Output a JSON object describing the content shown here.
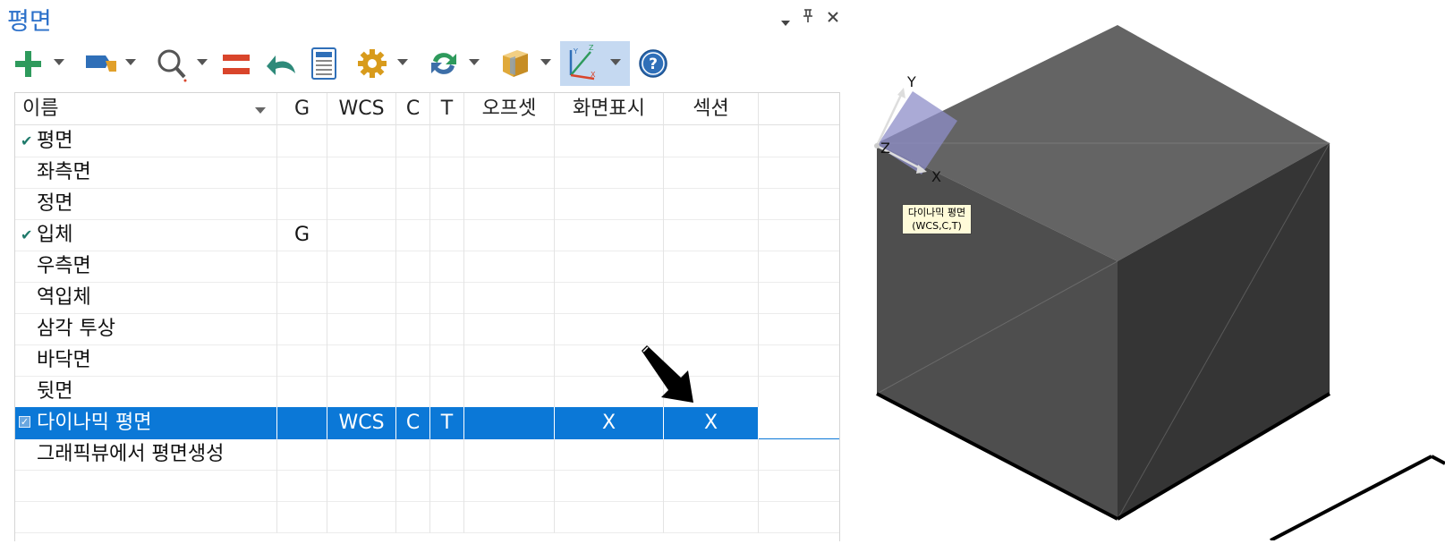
{
  "panel": {
    "title": "평면",
    "controls": {
      "dropdown": "▾",
      "pin": "ᵃ",
      "close": "✕"
    }
  },
  "toolbar": {
    "items": [
      {
        "icon": "add-icon",
        "dropdown": true
      },
      {
        "icon": "flag-icon",
        "dropdown": true
      },
      {
        "icon": "search-icon",
        "dropdown": true
      },
      {
        "icon": "equal-icon",
        "dropdown": false
      },
      {
        "icon": "undo-icon",
        "dropdown": false
      },
      {
        "icon": "calculator-icon",
        "dropdown": false
      },
      {
        "icon": "gear-icon",
        "dropdown": true
      },
      {
        "icon": "refresh-icon",
        "dropdown": true
      },
      {
        "icon": "box-icon",
        "dropdown": true
      },
      {
        "icon": "axes-icon",
        "dropdown": true,
        "active": true
      },
      {
        "icon": "help-icon",
        "dropdown": false
      }
    ],
    "colors": {
      "green": "#2e9a5c",
      "blue": "#2f6fb8",
      "red": "#d9452b",
      "gold": "#d89b1c"
    }
  },
  "grid": {
    "headers": [
      "이름",
      "G",
      "WCS",
      "C",
      "T",
      "오프셋",
      "화면표시",
      "섹션"
    ],
    "rows": [
      {
        "name": "평면",
        "checked": true,
        "g": "",
        "wcs": "",
        "c": "",
        "t": "",
        "offset": "",
        "display": "",
        "section": ""
      },
      {
        "name": "좌측면",
        "checked": false,
        "g": "",
        "wcs": "",
        "c": "",
        "t": "",
        "offset": "",
        "display": "",
        "section": ""
      },
      {
        "name": "정면",
        "checked": false,
        "g": "",
        "wcs": "",
        "c": "",
        "t": "",
        "offset": "",
        "display": "",
        "section": ""
      },
      {
        "name": "입체",
        "checked": true,
        "g": "G",
        "wcs": "",
        "c": "",
        "t": "",
        "offset": "",
        "display": "",
        "section": ""
      },
      {
        "name": "우측면",
        "checked": false,
        "g": "",
        "wcs": "",
        "c": "",
        "t": "",
        "offset": "",
        "display": "",
        "section": ""
      },
      {
        "name": "역입체",
        "checked": false,
        "g": "",
        "wcs": "",
        "c": "",
        "t": "",
        "offset": "",
        "display": "",
        "section": ""
      },
      {
        "name": "삼각 투상",
        "checked": false,
        "g": "",
        "wcs": "",
        "c": "",
        "t": "",
        "offset": "",
        "display": "",
        "section": ""
      },
      {
        "name": "바닥면",
        "checked": false,
        "g": "",
        "wcs": "",
        "c": "",
        "t": "",
        "offset": "",
        "display": "",
        "section": ""
      },
      {
        "name": "뒷면",
        "checked": false,
        "g": "",
        "wcs": "",
        "c": "",
        "t": "",
        "offset": "",
        "display": "",
        "section": ""
      },
      {
        "name": "다이나믹 평면",
        "checked": true,
        "selected": true,
        "g": "",
        "wcs": "WCS",
        "c": "C",
        "t": "T",
        "offset": "",
        "display": "X",
        "section": "X"
      },
      {
        "name": "그래픽뷰에서 평면생성",
        "checked": false,
        "g": "",
        "wcs": "",
        "c": "",
        "t": "",
        "offset": "",
        "display": "",
        "section": ""
      },
      {
        "name": "",
        "checked": false,
        "g": "",
        "wcs": "",
        "c": "",
        "t": "",
        "offset": "",
        "display": "",
        "section": ""
      },
      {
        "name": "",
        "checked": false,
        "g": "",
        "wcs": "",
        "c": "",
        "t": "",
        "offset": "",
        "display": "",
        "section": ""
      }
    ],
    "selection_color": "#0b78d7"
  },
  "view3d": {
    "axes": {
      "x": "X",
      "y": "Y",
      "z": "Z"
    },
    "tooltip": {
      "line1": "다이나믹 평면",
      "line2": "(WCS,C,T)"
    },
    "colors": {
      "top": "#646464",
      "left": "#4e4e4e",
      "right": "#353535"
    }
  }
}
